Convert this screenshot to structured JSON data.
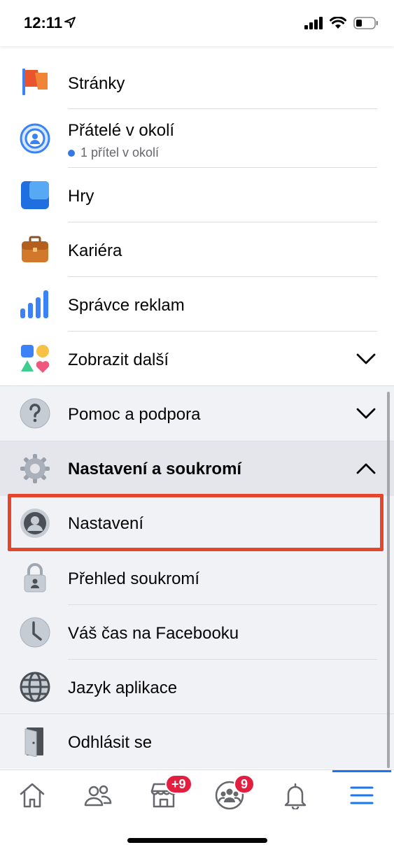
{
  "status_bar": {
    "time": "12:11"
  },
  "menu": {
    "items": [
      {
        "label": "Stránky",
        "icon": "pages-flag-icon"
      },
      {
        "label": "Přátelé v okolí",
        "sub": "1 přítel v okolí",
        "icon": "nearby-friends-icon"
      },
      {
        "label": "Hry",
        "icon": "games-icon"
      },
      {
        "label": "Kariéra",
        "icon": "briefcase-icon"
      },
      {
        "label": "Správce reklam",
        "icon": "ads-manager-icon"
      },
      {
        "label": "Zobrazit další",
        "icon": "see-more-shapes-icon"
      }
    ],
    "help": {
      "label": "Pomoc a podpora",
      "icon": "question-icon"
    },
    "settings_privacy": {
      "label": "Nastavení a soukromí",
      "icon": "gear-icon"
    },
    "settings_items": [
      {
        "label": "Nastavení",
        "icon": "profile-settings-icon"
      },
      {
        "label": "Přehled soukromí",
        "icon": "lock-icon"
      },
      {
        "label": "Váš čas na Facebooku",
        "icon": "clock-icon"
      },
      {
        "label": "Jazyk aplikace",
        "icon": "globe-icon"
      }
    ],
    "logout": {
      "label": "Odhlásit se",
      "icon": "door-icon"
    }
  },
  "tabbar": {
    "marketplace_badge": "+9",
    "groups_badge": "9"
  },
  "colors": {
    "accent": "#1877f2",
    "highlight": "#e5452b",
    "badge": "#e41e3f"
  }
}
